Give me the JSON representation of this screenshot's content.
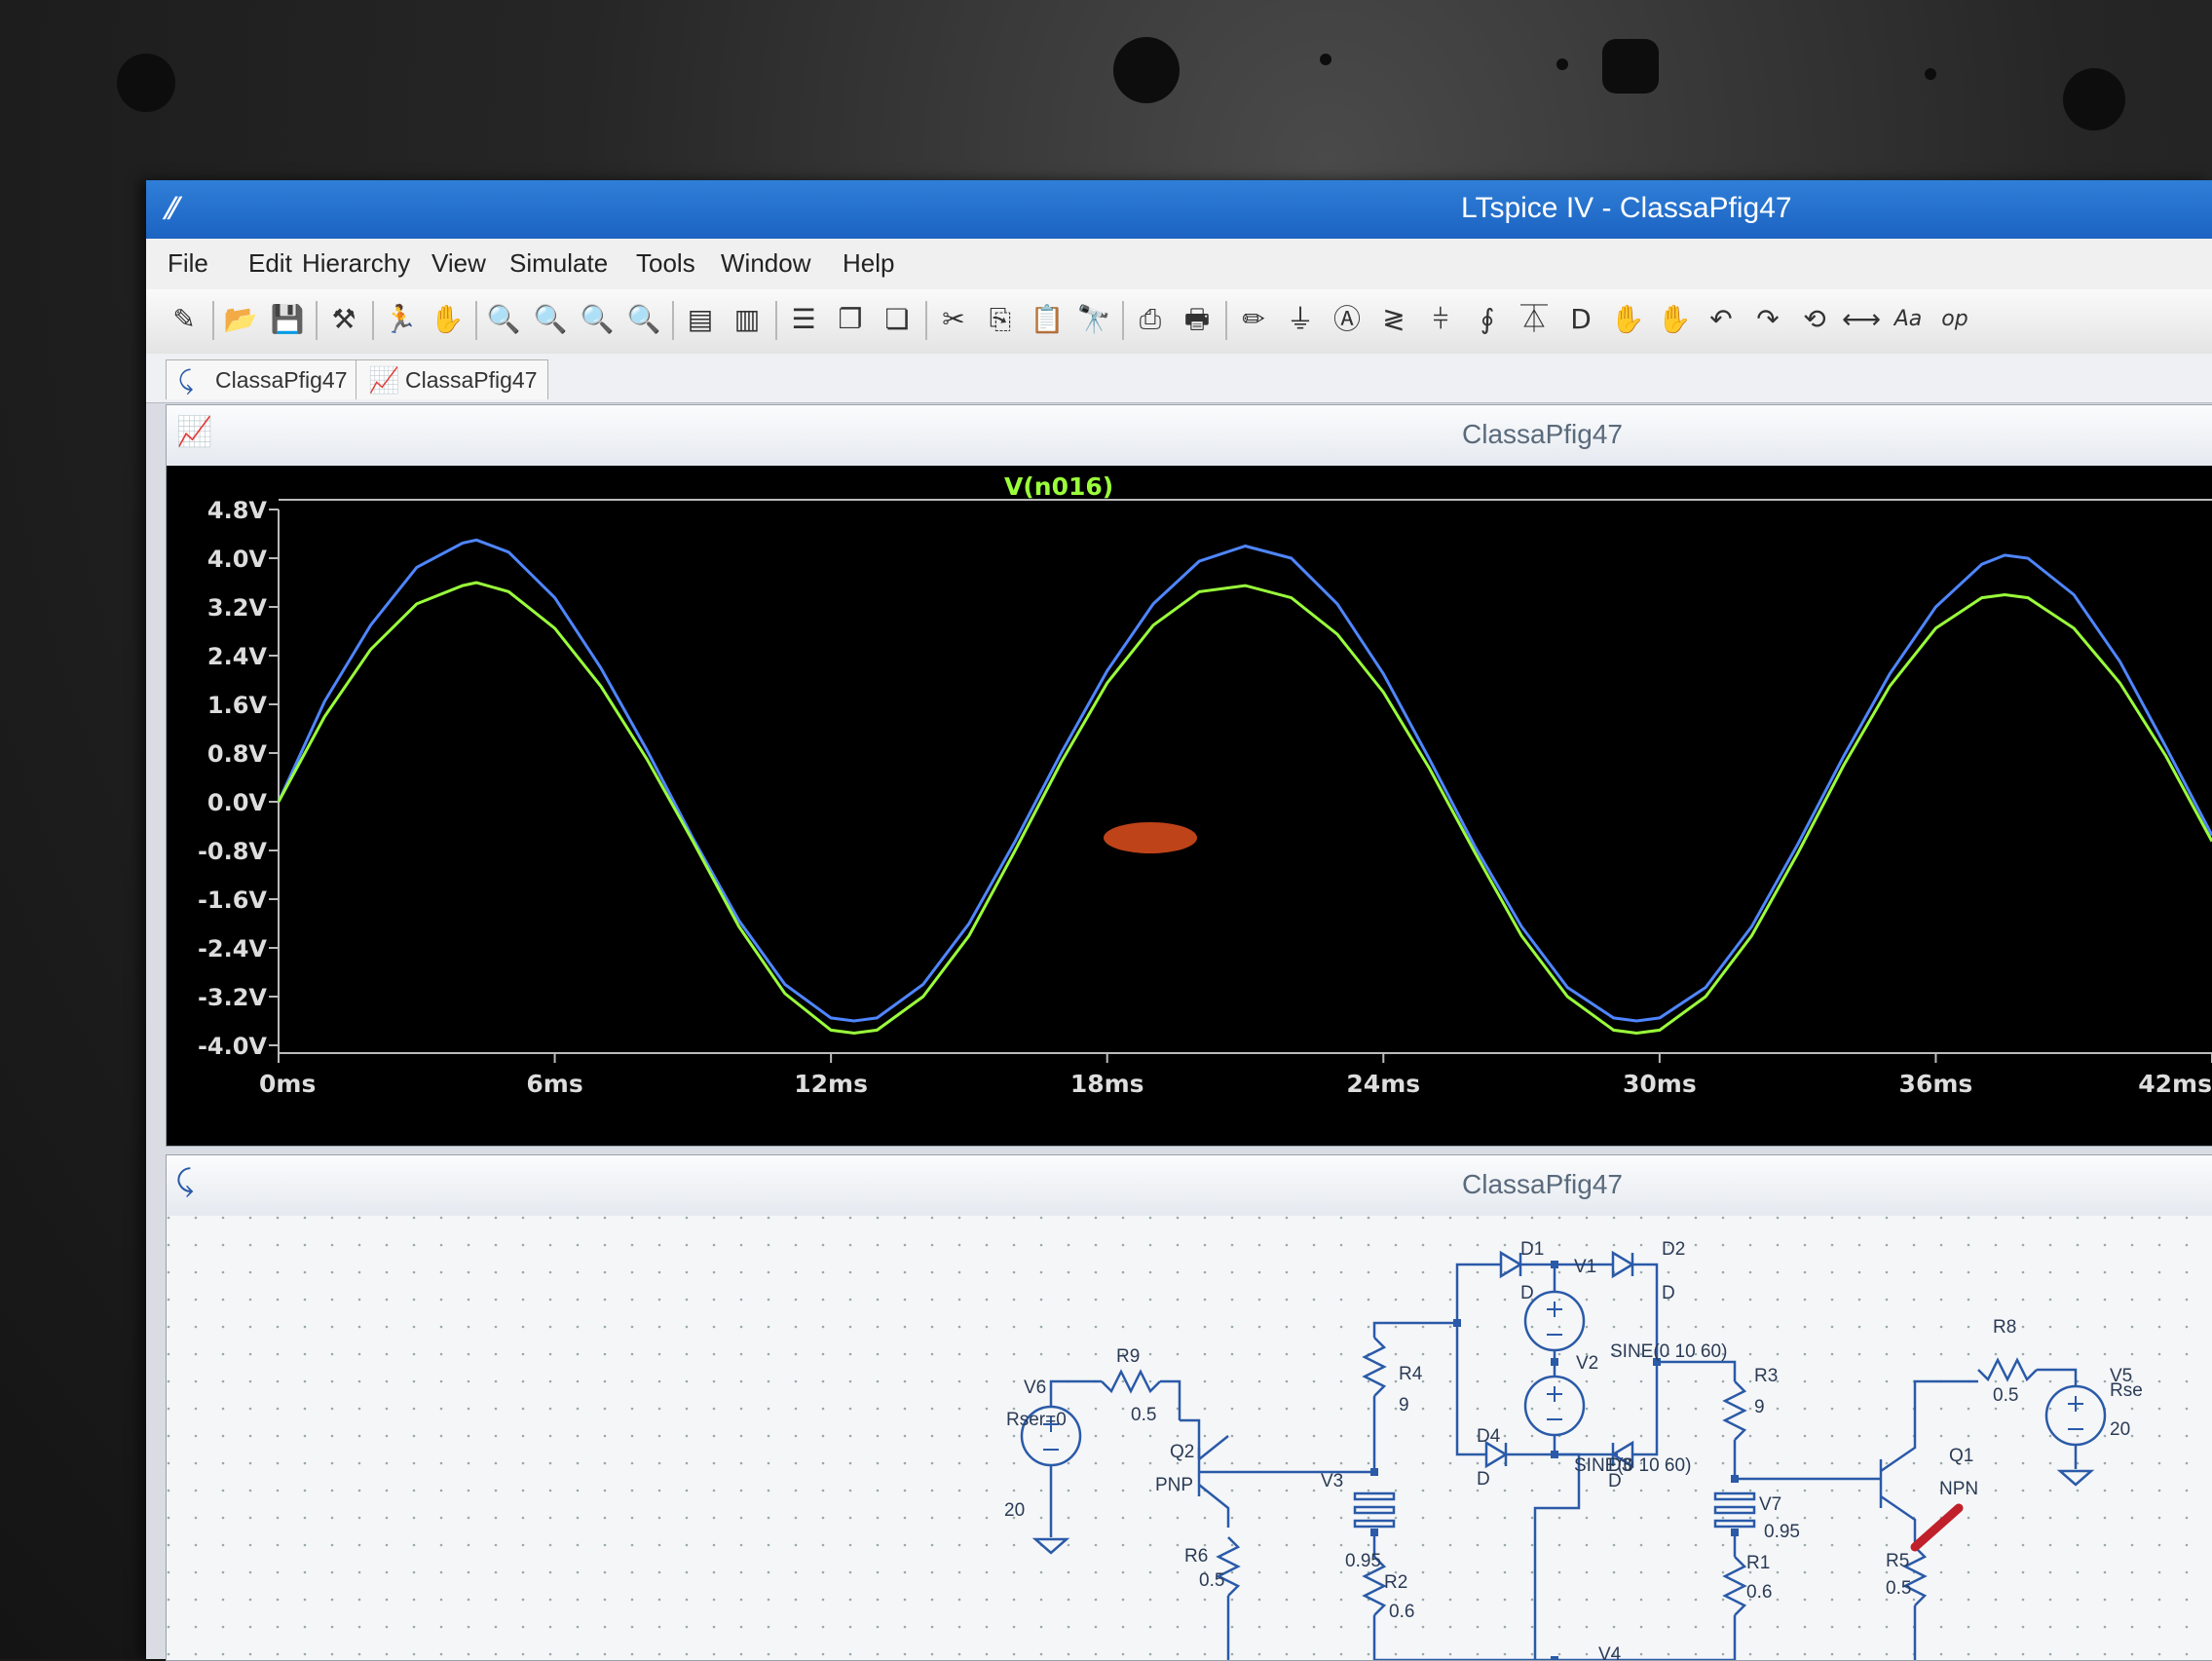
{
  "window": {
    "title": "LTspice IV - ClassaPfig47",
    "app_icon": "ltspice-icon"
  },
  "menu": {
    "items": [
      "File",
      "Edit",
      "Hierarchy",
      "View",
      "Simulate",
      "Tools",
      "Window",
      "Help"
    ]
  },
  "toolbar": {
    "buttons": [
      {
        "icon": "new-schematic-icon",
        "glyph": "✎"
      },
      {
        "icon": "open-folder-icon",
        "glyph": "📂"
      },
      {
        "icon": "save-icon",
        "glyph": "💾"
      },
      {
        "icon": "control-panel-icon",
        "glyph": "⚒"
      },
      {
        "icon": "run-icon",
        "glyph": "🏃"
      },
      {
        "icon": "halt-icon",
        "glyph": "✋"
      },
      {
        "icon": "zoom-in-icon",
        "glyph": "🔍"
      },
      {
        "icon": "pan-icon",
        "glyph": "🔍"
      },
      {
        "icon": "zoom-out-icon",
        "glyph": "🔍"
      },
      {
        "icon": "zoom-fit-icon",
        "glyph": "🔍"
      },
      {
        "icon": "autorange-icon",
        "glyph": "▤"
      },
      {
        "icon": "delete-trace-icon",
        "glyph": "▥"
      },
      {
        "icon": "tile-horizontal-icon",
        "glyph": "☰"
      },
      {
        "icon": "cascade-icon",
        "glyph": "❐"
      },
      {
        "icon": "tile-vertical-icon",
        "glyph": "❏"
      },
      {
        "icon": "cut-icon",
        "glyph": "✂"
      },
      {
        "icon": "copy-icon",
        "glyph": "⎘"
      },
      {
        "icon": "paste-icon",
        "glyph": "📋"
      },
      {
        "icon": "find-icon",
        "glyph": "🔭"
      },
      {
        "icon": "print-setup-icon",
        "glyph": "⎙"
      },
      {
        "icon": "print-icon",
        "glyph": "🖶"
      },
      {
        "icon": "wire-icon",
        "glyph": "✏"
      },
      {
        "icon": "ground-icon",
        "glyph": "⏚"
      },
      {
        "icon": "label-net-icon",
        "glyph": "Ⓐ"
      },
      {
        "icon": "resistor-icon",
        "glyph": "≷"
      },
      {
        "icon": "capacitor-icon",
        "glyph": "⫩"
      },
      {
        "icon": "inductor-icon",
        "glyph": "∮"
      },
      {
        "icon": "diode-icon",
        "glyph": "⏄"
      },
      {
        "icon": "component-icon",
        "glyph": "D"
      },
      {
        "icon": "move-icon",
        "glyph": "✋"
      },
      {
        "icon": "drag-icon",
        "glyph": "✋"
      },
      {
        "icon": "undo-icon",
        "glyph": "↶"
      },
      {
        "icon": "redo-icon",
        "glyph": "↷"
      },
      {
        "icon": "rotate-icon",
        "glyph": "⟲"
      },
      {
        "icon": "mirror-icon",
        "glyph": "⟷"
      },
      {
        "icon": "text-icon",
        "glyph": "Aa"
      },
      {
        "icon": "spice-directive-icon",
        "glyph": "op"
      }
    ]
  },
  "tabs": [
    {
      "label": "ClassaPfig47",
      "icon": "schematic-icon",
      "glyph": "⤹"
    },
    {
      "label": "ClassaPfig47",
      "icon": "waveform-icon",
      "glyph": "📈"
    }
  ],
  "plot_pane": {
    "title": "ClassaPfig47",
    "icon_glyph": "📈",
    "trace_label": "V(n016)"
  },
  "schematic_pane": {
    "title": "ClassaPfig47",
    "icon_glyph": "⤹",
    "labels": [
      {
        "text": "D1"
      },
      {
        "text": "D"
      },
      {
        "text": "V1"
      },
      {
        "text": "D2"
      },
      {
        "text": "D"
      },
      {
        "text": "SINE(0 10 60)"
      },
      {
        "text": "V6"
      },
      {
        "text": "R9"
      },
      {
        "text": "Rser=0"
      },
      {
        "text": "0.5"
      },
      {
        "text": "20"
      },
      {
        "text": "Q2"
      },
      {
        "text": "PNP"
      },
      {
        "text": "R4"
      },
      {
        "text": "9"
      },
      {
        "text": "V3"
      },
      {
        "text": "V2"
      },
      {
        "text": "D4"
      },
      {
        "text": "D"
      },
      {
        "text": "D3"
      },
      {
        "text": "SINE(0 10 60)"
      },
      {
        "text": "D"
      },
      {
        "text": "R3"
      },
      {
        "text": "9"
      },
      {
        "text": "V7"
      },
      {
        "text": "0.95"
      },
      {
        "text": "0.95"
      },
      {
        "text": "R8"
      },
      {
        "text": "0.5"
      },
      {
        "text": "V5"
      },
      {
        "text": "Rse"
      },
      {
        "text": "20"
      },
      {
        "text": "Q1"
      },
      {
        "text": "NPN"
      },
      {
        "text": "R6"
      },
      {
        "text": "0.5"
      },
      {
        "text": "R2"
      },
      {
        "text": "0.6"
      },
      {
        "text": "R1"
      },
      {
        "text": "0.6"
      },
      {
        "text": "R5"
      },
      {
        "text": "0.5"
      },
      {
        "text": "V4"
      }
    ]
  },
  "chart_data": {
    "type": "line",
    "x_unit": "ms",
    "x_ticks": [
      "0ms",
      "6ms",
      "12ms",
      "18ms",
      "24ms",
      "30ms",
      "36ms",
      "42ms"
    ],
    "x_tick_values": [
      0,
      6,
      12,
      18,
      24,
      30,
      36,
      42
    ],
    "y_ticks": [
      "4.8V",
      "4.0V",
      "3.2V",
      "2.4V",
      "1.6V",
      "0.8V",
      "0.0V",
      "-0.8V",
      "-1.6V",
      "-2.4V",
      "-3.2V",
      "-4.0V"
    ],
    "y_tick_values": [
      4.8,
      4.0,
      3.2,
      2.4,
      1.6,
      0.8,
      0.0,
      -0.8,
      -1.6,
      -2.4,
      -3.2,
      -4.0
    ],
    "xlim": [
      0,
      42
    ],
    "ylim": [
      -4.0,
      4.8
    ],
    "grid": false,
    "background": "#000000",
    "series": [
      {
        "name": "V(n016)",
        "color": "#4f86ff",
        "x": [
          0,
          1,
          2,
          3,
          4,
          4.3,
          5,
          6,
          7,
          8,
          9,
          10,
          11,
          12,
          12.5,
          13,
          14,
          15,
          16,
          17,
          18,
          19,
          20,
          21,
          21.0,
          22,
          23,
          24,
          25,
          26,
          27,
          28,
          29,
          29.5,
          30,
          31,
          32,
          33,
          34,
          35,
          36,
          37,
          37.5,
          38,
          39,
          40,
          41,
          42
        ],
        "y": [
          0.0,
          1.65,
          2.9,
          3.85,
          4.25,
          4.3,
          4.1,
          3.35,
          2.2,
          0.85,
          -0.6,
          -1.95,
          -3.0,
          -3.55,
          -3.6,
          -3.55,
          -3.0,
          -2.0,
          -0.65,
          0.8,
          2.15,
          3.25,
          3.95,
          4.2,
          4.2,
          4.0,
          3.25,
          2.1,
          0.7,
          -0.75,
          -2.05,
          -3.05,
          -3.55,
          -3.6,
          -3.55,
          -3.05,
          -2.05,
          -0.7,
          0.75,
          2.1,
          3.2,
          3.9,
          4.05,
          4.0,
          3.4,
          2.3,
          0.9,
          -0.55
        ]
      },
      {
        "name": "",
        "color": "#9aff3a",
        "x": [
          0,
          1,
          2,
          3,
          4,
          4.3,
          5,
          6,
          7,
          8,
          9,
          10,
          11,
          12,
          12.5,
          13,
          14,
          15,
          16,
          17,
          18,
          19,
          20,
          21,
          22,
          23,
          24,
          25,
          26,
          27,
          28,
          29,
          29.5,
          30,
          31,
          32,
          33,
          34,
          35,
          36,
          37,
          37.5,
          38,
          39,
          40,
          41,
          42
        ],
        "y": [
          0.0,
          1.4,
          2.5,
          3.25,
          3.55,
          3.6,
          3.45,
          2.85,
          1.9,
          0.7,
          -0.65,
          -2.05,
          -3.15,
          -3.75,
          -3.8,
          -3.75,
          -3.2,
          -2.2,
          -0.8,
          0.65,
          1.95,
          2.9,
          3.45,
          3.55,
          3.35,
          2.75,
          1.8,
          0.55,
          -0.85,
          -2.2,
          -3.2,
          -3.75,
          -3.8,
          -3.75,
          -3.2,
          -2.2,
          -0.85,
          0.6,
          1.9,
          2.85,
          3.35,
          3.4,
          3.35,
          2.85,
          1.95,
          0.75,
          -0.65
        ]
      }
    ]
  }
}
